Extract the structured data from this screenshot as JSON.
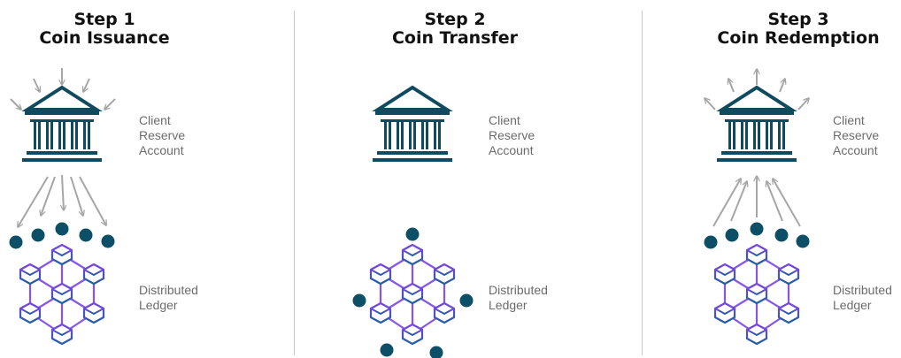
{
  "steps": [
    {
      "heading": "Step 1",
      "subheading": "Coin Issuance",
      "account_label": [
        "Client",
        "Reserve",
        "Account"
      ],
      "ledger_label": [
        "Distributed",
        "Ledger"
      ]
    },
    {
      "heading": "Step 2",
      "subheading": "Coin Transfer",
      "account_label": [
        "Client",
        "Reserve",
        "Account"
      ],
      "ledger_label": [
        "Distributed",
        "Ledger"
      ]
    },
    {
      "heading": "Step 3",
      "subheading": "Coin Redemption",
      "account_label": [
        "Client",
        "Reserve",
        "Account"
      ],
      "ledger_label": [
        "Distributed",
        "Ledger"
      ]
    }
  ],
  "colors": {
    "bank": "#0f4a5e",
    "coin": "#0d4f66",
    "arrow": "#a6a6a6",
    "ledger_top": "#7b44e6",
    "ledger_bottom": "#1f5fa0",
    "label": "#6b6b6b",
    "title": "#111111"
  },
  "icons": [
    "bank-icon",
    "coin-icon",
    "arrow-icon",
    "blockchain-ledger-icon"
  ]
}
